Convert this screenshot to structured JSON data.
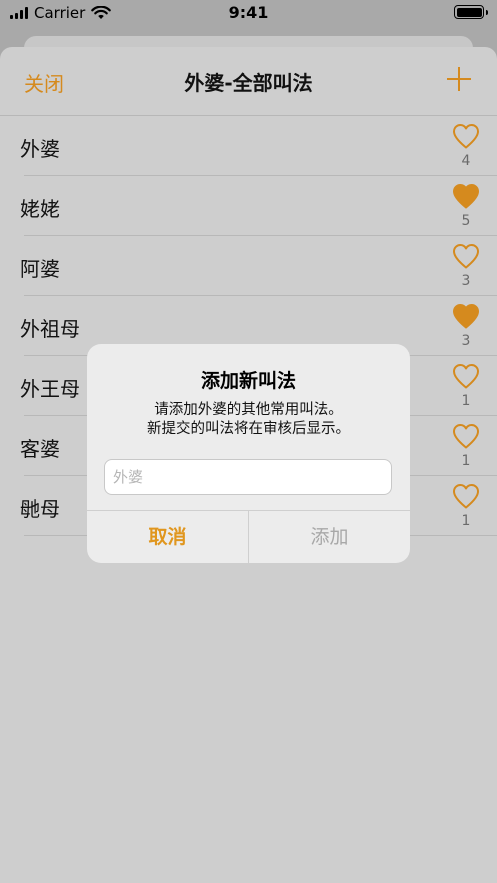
{
  "status_bar": {
    "carrier": "Carrier",
    "time": "9:41"
  },
  "nav": {
    "close_label": "关闭",
    "title": "外婆-全部叫法",
    "add_icon": "plus-icon"
  },
  "colors": {
    "accent": "#d58a1e",
    "heart_filled": "#d58a1e"
  },
  "items": [
    {
      "name": "外婆",
      "likes": "4",
      "liked": false
    },
    {
      "name": "姥姥",
      "likes": "5",
      "liked": true
    },
    {
      "name": "阿婆",
      "likes": "3",
      "liked": false
    },
    {
      "name": "外祖母",
      "likes": "3",
      "liked": true
    },
    {
      "name": "外王母",
      "likes": "1",
      "liked": false
    },
    {
      "name": "客婆",
      "likes": "1",
      "liked": false
    },
    {
      "name": "毑母",
      "likes": "1",
      "liked": false
    }
  ],
  "alert": {
    "title": "添加新叫法",
    "message_line1": "请添加外婆的其他常用叫法。",
    "message_line2": "新提交的叫法将在审核后显示。",
    "input_placeholder": "外婆",
    "input_value": "",
    "cancel_label": "取消",
    "confirm_label": "添加"
  }
}
